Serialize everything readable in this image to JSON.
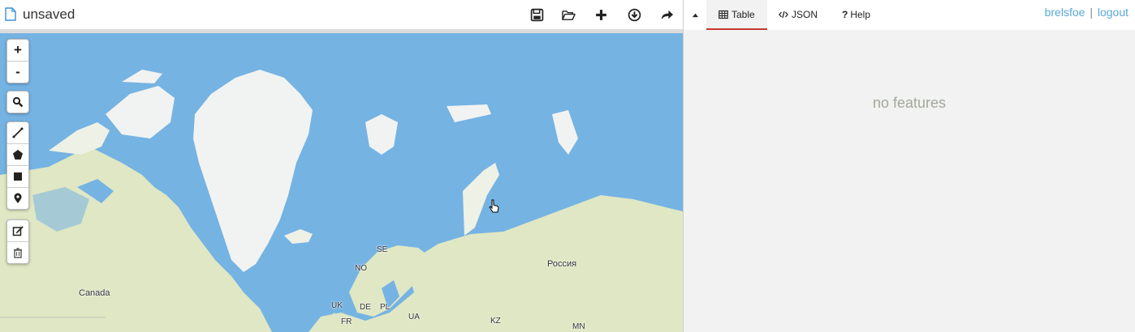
{
  "header": {
    "title": "unsaved",
    "icons": [
      "file-icon",
      "save-icon",
      "open-folder-icon",
      "plus-icon",
      "download-icon",
      "share-icon"
    ],
    "colors": {
      "tab_active_border": "#c43a2c",
      "link": "#5aa9d6",
      "water": "#75b3e3",
      "land": "#dfe7c4",
      "ice": "#f1f3f2"
    }
  },
  "map": {
    "labels": {
      "canada": "Canada",
      "russia": "Россия",
      "se": "SE",
      "no": "NO",
      "uk": "UK",
      "de": "DE",
      "pl": "PL",
      "ua": "UA",
      "fr": "FR",
      "kz": "KZ",
      "mn": "MN"
    },
    "controls": {
      "zoom_in": "+",
      "zoom_out": "-"
    }
  },
  "panel": {
    "tabs": [
      {
        "label": "Table",
        "icon": "table-icon",
        "active": true
      },
      {
        "label": "JSON",
        "icon": "code-icon",
        "active": false
      },
      {
        "label": "Help",
        "icon": "question-icon",
        "active": false
      }
    ],
    "user": {
      "name": "brelsfoe",
      "separator": "|",
      "logout": "logout"
    },
    "empty_message": "no features"
  }
}
